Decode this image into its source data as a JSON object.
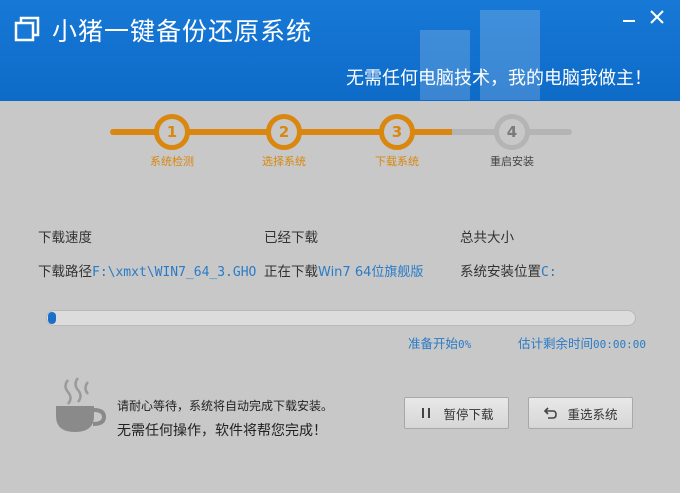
{
  "header": {
    "app_title": "小猪一键备份还原系统",
    "slogan": "无需任何电脑技术，我的电脑我做主！"
  },
  "steps": [
    {
      "num": "1",
      "label": "系统检测",
      "state": "done"
    },
    {
      "num": "2",
      "label": "选择系统",
      "state": "done"
    },
    {
      "num": "3",
      "label": "下载系统",
      "state": "current"
    },
    {
      "num": "4",
      "label": "重启安装",
      "state": "todo"
    }
  ],
  "info": {
    "speed_label": "下载速度",
    "downloaded_label": "已经下载",
    "total_label": "总共大小",
    "path_label": "下载路径",
    "path_value": "F:\\xmxt\\WIN7_64_3.GHO",
    "downloading_label": "正在下载",
    "downloading_value": "Win7 64位旗舰版",
    "install_pos_label": "系统安装位置",
    "install_pos_value": "C:"
  },
  "progress": {
    "fraction": 0.01,
    "start_label": "准备开始",
    "percent": "0%",
    "remain_label": "估计剩余时间",
    "remain_value": "00:00:00"
  },
  "footer": {
    "msg1": "请耐心等待，系统将自动完成下载安装。",
    "msg2": "无需任何操作，软件将帮您完成！",
    "pause_label": "暂停下载",
    "reselect_label": "重选系统"
  },
  "colors": {
    "header_blue": "#1778d6",
    "step_orange": "#d9870f",
    "value_blue": "#2a7bc7"
  }
}
